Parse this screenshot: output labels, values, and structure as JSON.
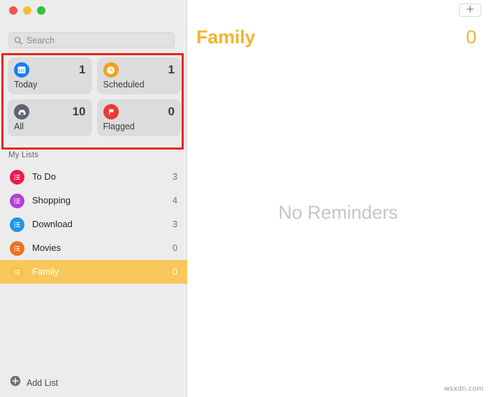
{
  "window": {
    "traffic_lights": [
      {
        "name": "close",
        "color": "#f1564f"
      },
      {
        "name": "minimize",
        "color": "#f5bd36"
      },
      {
        "name": "maximize",
        "color": "#2cc43c"
      }
    ]
  },
  "sidebar": {
    "search": {
      "placeholder": "Search",
      "value": "",
      "icon": "search-icon"
    },
    "smart_lists": [
      {
        "key": "today",
        "label": "Today",
        "count": "1",
        "icon": "calendar-icon",
        "color": "#1a7ef0"
      },
      {
        "key": "scheduled",
        "label": "Scheduled",
        "count": "1",
        "icon": "clock-icon",
        "color": "#f0a022"
      },
      {
        "key": "all",
        "label": "All",
        "count": "10",
        "icon": "tray-icon",
        "color": "#5d6470"
      },
      {
        "key": "flagged",
        "label": "Flagged",
        "count": "0",
        "icon": "flag-icon",
        "color": "#ec3a31"
      }
    ],
    "section_title": "My Lists",
    "lists": [
      {
        "label": "To Do",
        "count": "3",
        "color": "#f4194f",
        "selected": false
      },
      {
        "label": "Shopping",
        "count": "4",
        "color": "#b341d8",
        "selected": false
      },
      {
        "label": "Download",
        "count": "3",
        "color": "#2095e8",
        "selected": false
      },
      {
        "label": "Movies",
        "count": "0",
        "color": "#f0701f",
        "selected": false
      },
      {
        "label": "Family",
        "count": "0",
        "color": "#f6c44a",
        "selected": true
      }
    ],
    "add_list": {
      "label": "Add List",
      "icon": "plus-circle-icon"
    }
  },
  "main": {
    "add_reminder_button": {
      "icon": "plus-icon",
      "label": "+"
    },
    "title": "Family",
    "count": "0",
    "empty_message": "No Reminders",
    "accent_color": "#f2b430"
  },
  "annotation": {
    "type": "highlight-rectangle",
    "color": "#e8261c",
    "target": "smart-lists-grid"
  },
  "watermark": "wsxdn.com"
}
